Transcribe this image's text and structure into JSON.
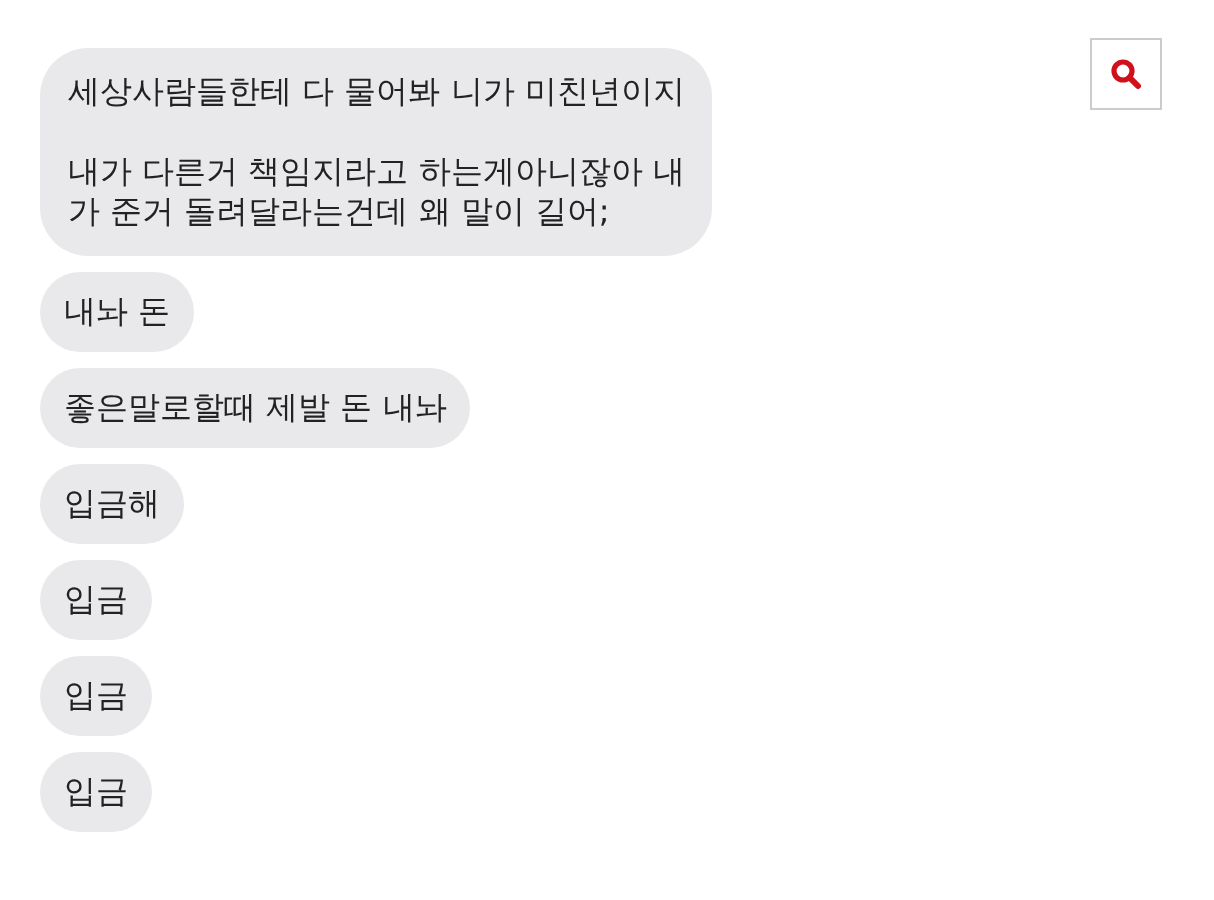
{
  "messages": [
    {
      "text": "세상사람들한테 다 물어봐 니가 미친년이지\n\n내가 다른거 책임지라고 하는게아니잖아 내\n가 준거 돌려달라는건데 왜 말이 길어;"
    },
    {
      "text": "내놔 돈"
    },
    {
      "text": "좋은말로할때 제발 돈 내놔"
    },
    {
      "text": "입금해"
    },
    {
      "text": "입금"
    },
    {
      "text": "입금"
    },
    {
      "text": "입금"
    }
  ]
}
